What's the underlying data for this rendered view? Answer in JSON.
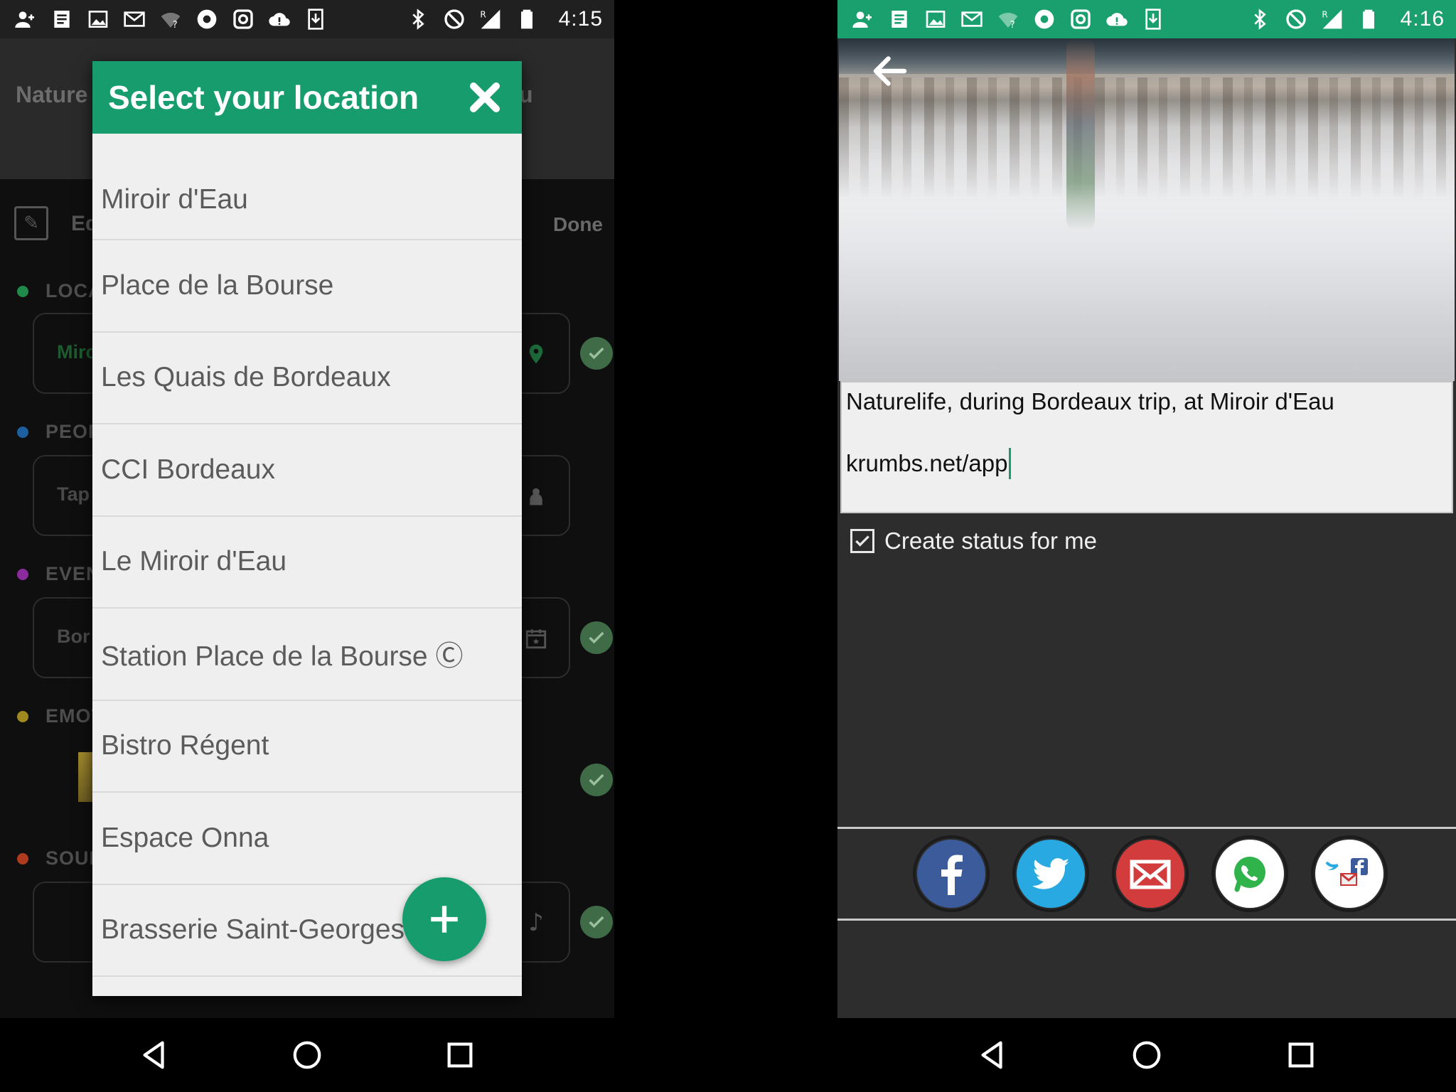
{
  "left_phone": {
    "status_bar": {
      "time": "4:15"
    },
    "background_screen": {
      "app_title": "Nature",
      "app_title_right": "u",
      "edit_label": "Ed",
      "done_label": "Done",
      "sections": [
        {
          "label": "LOCA",
          "color": "#1f8a4c"
        },
        {
          "label": "PEOP",
          "color": "#1e5fa0"
        },
        {
          "label": "EVEN",
          "color": "#8a2c9e"
        },
        {
          "label": "EMOT",
          "color": "#a08a1e"
        },
        {
          "label": "SOUI",
          "color": "#b03a1e"
        }
      ],
      "fields": [
        {
          "text": "Mirc",
          "icon": "location-pin-icon"
        },
        {
          "text": "Tap",
          "icon": "person-icon"
        },
        {
          "text": "Bor",
          "icon": "calendar-icon"
        },
        {
          "text": "",
          "icon": "music-note-icon"
        }
      ]
    },
    "dialog": {
      "title": "Select your location",
      "locations": [
        "Miroir d'Eau",
        "Place de la Bourse",
        "Les Quais de Bordeaux",
        "CCI Bordeaux",
        "Le Miroir d'Eau",
        "Station Place de la Bourse Ⓒ",
        "Bistro Régent",
        "Espace Onna",
        "Brasserie Saint-Georges"
      ]
    }
  },
  "right_phone": {
    "status_bar": {
      "time": "4:16"
    },
    "status_text_line1": "Naturelife,  during Bordeaux trip,  at Miroir d'Eau",
    "status_text_line2": "krumbs.net/app",
    "checkbox": {
      "label": "Create status for me",
      "checked": true
    },
    "share_targets": [
      "facebook",
      "twitter",
      "email",
      "whatsapp",
      "multi-share"
    ]
  },
  "colors": {
    "accent_green": "#179d6d",
    "status_bar_green": "#1aa06f",
    "dialog_bg": "#efefef"
  }
}
